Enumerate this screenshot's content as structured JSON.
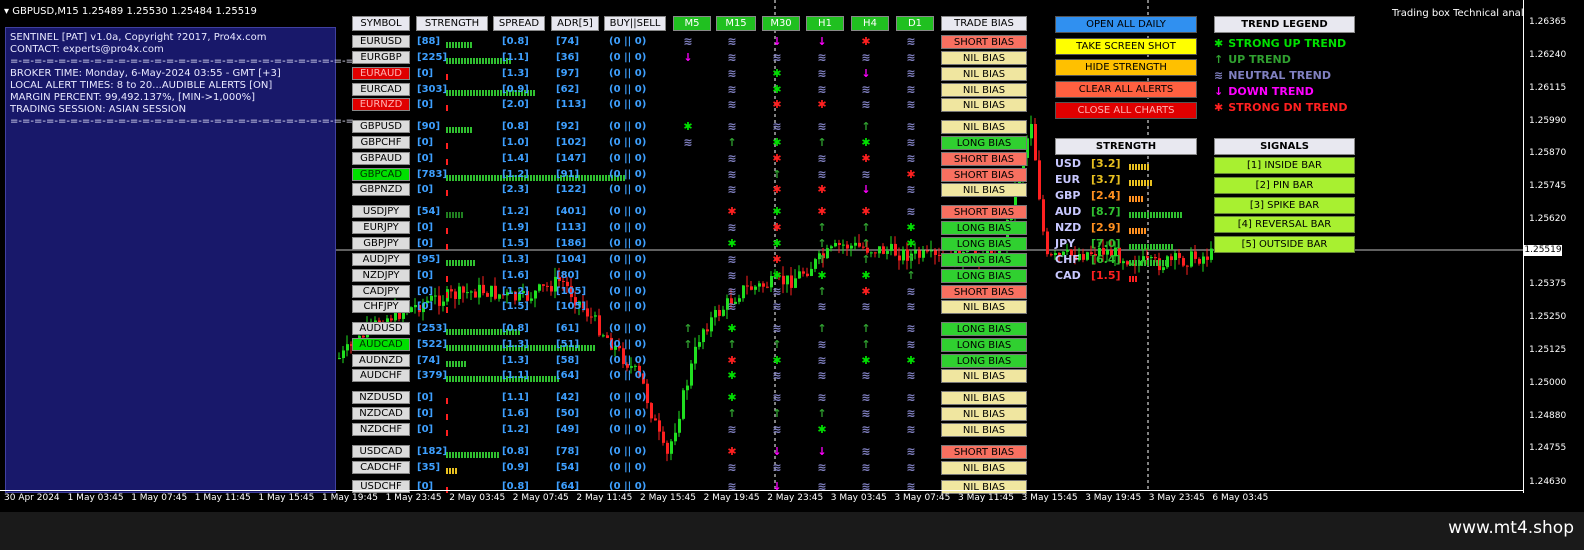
{
  "window": {
    "title": "GBPUSD,M15  1.25489 1.25530 1.25484 1.25519",
    "corner_label": "Trading box Technical analysis"
  },
  "info_panel": {
    "lines": [
      "SENTINEL [PAT] v1.0a, Copyright ?2017, Pro4x.com",
      "CONTACT: experts@pro4x.com",
      "=-=-=-=-=-=-=-=-=-=-=-=-=-=-=-=-=-=-=-=-=-=-=-=-=-=-=-=-=-",
      "BROKER TIME: Monday, 6-May-2024 03:55 - GMT [+3]",
      "LOCAL ALERT TIMES: 8 to 20...AUDIBLE ALERTS [ON]",
      "MARGIN PERCENT: 99,492.137%, [MIN->1,000%]",
      "TRADING SESSION: ASIAN SESSION",
      "=-=-=-=-=-=-=-=-=-=-=-=-=-=-=-=-=-=-=-=-=-=-=-=-=-=-=-=-=-"
    ]
  },
  "headers": {
    "symbol": "SYMBOL",
    "strength": "STRENGTH",
    "spread": "SPREAD",
    "adr": "ADR[5]",
    "buysell": "BUY||SELL",
    "timeframes": [
      "M5",
      "M15",
      "M30",
      "H1",
      "H4",
      "D1"
    ],
    "trade_bias": "TRADE BIAS"
  },
  "colors": {
    "strong_up": "#00e000",
    "up": "#30a030",
    "neutral": "#8080c0",
    "down": "#ff00ff",
    "strong_down": "#ff2020"
  },
  "icons": {
    "strong_up": "✱",
    "up": "↑",
    "neutral": "≋",
    "down": "↓",
    "strong_down": "✱"
  },
  "rows": [
    {
      "symbol": "EURUSD",
      "state": "normal",
      "strength": "[88]",
      "bars": 9,
      "bar_color": "#30c030",
      "spread": "[0.8]",
      "adr": "[74]",
      "buysell": "(0 || 0)",
      "tf": [
        "neutral",
        "neutral",
        "down",
        "down",
        "strong_down",
        "neutral"
      ],
      "bias": "SHORT BIAS",
      "bias_type": "short"
    },
    {
      "symbol": "EURGBP",
      "state": "normal",
      "strength": "[225]",
      "bars": 22,
      "bar_color": "#30c030",
      "spread": "[1.1]",
      "adr": "[36]",
      "buysell": "(0 || 0)",
      "tf": [
        "down",
        "neutral",
        "neutral",
        "neutral",
        "neutral",
        "neutral"
      ],
      "bias": "NIL BIAS",
      "bias_type": "nil"
    },
    {
      "symbol": "EURAUD",
      "state": "red",
      "strength": "[0]",
      "bars": 1,
      "bar_color": "#ff2020",
      "spread": "[1.3]",
      "adr": "[97]",
      "buysell": "(0 || 0)",
      "tf": [
        "",
        "neutral",
        "strong_up",
        "neutral",
        "down",
        "neutral"
      ],
      "bias": "NIL BIAS",
      "bias_type": "nil"
    },
    {
      "symbol": "EURCAD",
      "state": "normal",
      "strength": "[303]",
      "bars": 30,
      "bar_color": "#30c030",
      "spread": "[0.9]",
      "adr": "[62]",
      "buysell": "(0 || 0)",
      "tf": [
        "",
        "neutral",
        "strong_up",
        "neutral",
        "neutral",
        "neutral"
      ],
      "bias": "NIL BIAS",
      "bias_type": "nil"
    },
    {
      "symbol": "EURNZD",
      "state": "red",
      "strength": "[0]",
      "bars": 1,
      "bar_color": "#ff2020",
      "spread": "[2.0]",
      "adr": "[113]",
      "buysell": "(0 || 0)",
      "tf": [
        "",
        "neutral",
        "strong_down",
        "strong_down",
        "neutral",
        "neutral"
      ],
      "bias": "NIL BIAS",
      "bias_type": "nil"
    },
    {
      "symbol": "GBPUSD",
      "state": "normal",
      "strength": "[90]",
      "bars": 9,
      "bar_color": "#30c030",
      "spread": "[0.8]",
      "adr": "[92]",
      "buysell": "(0 || 0)",
      "tf": [
        "strong_up",
        "neutral",
        "neutral",
        "neutral",
        "up",
        "neutral"
      ],
      "bias": "NIL BIAS",
      "bias_type": "nil"
    },
    {
      "symbol": "GBPCHF",
      "state": "normal",
      "strength": "[0]",
      "bars": 1,
      "bar_color": "#ff2020",
      "spread": "[1.0]",
      "adr": "[102]",
      "buysell": "(0 || 0)",
      "tf": [
        "neutral",
        "up",
        "strong_up",
        "up",
        "strong_up",
        "neutral"
      ],
      "bias": "LONG BIAS",
      "bias_type": "long"
    },
    {
      "symbol": "GBPAUD",
      "state": "normal",
      "strength": "[0]",
      "bars": 1,
      "bar_color": "#ff2020",
      "spread": "[1.4]",
      "adr": "[147]",
      "buysell": "(0 || 0)",
      "tf": [
        "",
        "neutral",
        "strong_down",
        "neutral",
        "strong_down",
        "neutral"
      ],
      "bias": "SHORT BIAS",
      "bias_type": "short"
    },
    {
      "symbol": "GBPCAD",
      "state": "green",
      "strength": "[783]",
      "bars": 60,
      "bar_color": "#30c030",
      "spread": "[1.2]",
      "adr": "[91]",
      "buysell": "(0 || 0)",
      "tf": [
        "",
        "neutral",
        "up",
        "neutral",
        "neutral",
        "strong_down"
      ],
      "bias": "SHORT BIAS",
      "bias_type": "short"
    },
    {
      "symbol": "GBPNZD",
      "state": "normal",
      "strength": "[0]",
      "bars": 1,
      "bar_color": "#ff2020",
      "spread": "[2.3]",
      "adr": "[122]",
      "buysell": "(0 || 0)",
      "tf": [
        "",
        "neutral",
        "strong_down",
        "strong_down",
        "down",
        "neutral"
      ],
      "bias": "NIL BIAS",
      "bias_type": "nil"
    },
    {
      "symbol": "USDJPY",
      "state": "normal",
      "strength": "[54]",
      "bars": 6,
      "bar_color": "#208020",
      "spread": "[1.2]",
      "adr": "[401]",
      "buysell": "(0 || 0)",
      "tf": [
        "",
        "strong_down",
        "strong_up",
        "strong_down",
        "strong_down",
        "neutral"
      ],
      "bias": "SHORT BIAS",
      "bias_type": "short"
    },
    {
      "symbol": "EURJPY",
      "state": "normal",
      "strength": "[0]",
      "bars": 1,
      "bar_color": "#ff2020",
      "spread": "[1.9]",
      "adr": "[113]",
      "buysell": "(0 || 0)",
      "tf": [
        "",
        "neutral",
        "strong_down",
        "up",
        "up",
        "strong_up"
      ],
      "bias": "LONG BIAS",
      "bias_type": "long"
    },
    {
      "symbol": "GBPJPY",
      "state": "normal",
      "strength": "[0]",
      "bars": 1,
      "bar_color": "#ff2020",
      "spread": "[1.5]",
      "adr": "[186]",
      "buysell": "(0 || 0)",
      "tf": [
        "",
        "strong_up",
        "strong_up",
        "up",
        "up",
        "strong_up"
      ],
      "bias": "LONG BIAS",
      "bias_type": "long"
    },
    {
      "symbol": "AUDJPY",
      "state": "normal",
      "strength": "[95]",
      "bars": 10,
      "bar_color": "#30c030",
      "spread": "[1.3]",
      "adr": "[104]",
      "buysell": "(0 || 0)",
      "tf": [
        "",
        "neutral",
        "strong_down",
        "up",
        "up",
        "up"
      ],
      "bias": "LONG BIAS",
      "bias_type": "long"
    },
    {
      "symbol": "NZDJPY",
      "state": "normal",
      "strength": "[0]",
      "bars": 1,
      "bar_color": "#ff2020",
      "spread": "[1.6]",
      "adr": "[80]",
      "buysell": "(0 || 0)",
      "tf": [
        "",
        "neutral",
        "strong_up",
        "strong_up",
        "strong_up",
        "up"
      ],
      "bias": "LONG BIAS",
      "bias_type": "long"
    },
    {
      "symbol": "CADJPY",
      "state": "normal",
      "strength": "[0]",
      "bars": 1,
      "bar_color": "#ff2020",
      "spread": "[1.2]",
      "adr": "[105]",
      "buysell": "(0 || 0)",
      "tf": [
        "",
        "neutral",
        "neutral",
        "up",
        "strong_down",
        "neutral"
      ],
      "bias": "SHORT BIAS",
      "bias_type": "short"
    },
    {
      "symbol": "CHFJPY",
      "state": "normal",
      "strength": "[0]",
      "bars": 1,
      "bar_color": "#ff2020",
      "spread": "[1.5]",
      "adr": "[105]",
      "buysell": "(0 || 0)",
      "tf": [
        "",
        "neutral",
        "neutral",
        "neutral",
        "neutral",
        "neutral"
      ],
      "bias": "NIL BIAS",
      "bias_type": "nil"
    },
    {
      "symbol": "AUDUSD",
      "state": "normal",
      "strength": "[253]",
      "bars": 25,
      "bar_color": "#30c030",
      "spread": "[0.8]",
      "adr": "[61]",
      "buysell": "(0 || 0)",
      "tf": [
        "up",
        "strong_up",
        "neutral",
        "up",
        "up",
        "neutral"
      ],
      "bias": "LONG BIAS",
      "bias_type": "long"
    },
    {
      "symbol": "AUDCAD",
      "state": "green",
      "strength": "[522]",
      "bars": 50,
      "bar_color": "#30c030",
      "spread": "[1.3]",
      "adr": "[51]",
      "buysell": "(0 || 0)",
      "tf": [
        "up",
        "up",
        "up",
        "neutral",
        "up",
        "neutral"
      ],
      "bias": "LONG BIAS",
      "bias_type": "long"
    },
    {
      "symbol": "AUDNZD",
      "state": "normal",
      "strength": "[74]",
      "bars": 7,
      "bar_color": "#30c030",
      "spread": "[1.3]",
      "adr": "[58]",
      "buysell": "(0 || 0)",
      "tf": [
        "",
        "strong_down",
        "strong_up",
        "neutral",
        "strong_up",
        "strong_up"
      ],
      "bias": "LONG BIAS",
      "bias_type": "long"
    },
    {
      "symbol": "AUDCHF",
      "state": "normal",
      "strength": "[379]",
      "bars": 38,
      "bar_color": "#30c030",
      "spread": "[1.1]",
      "adr": "[64]",
      "buysell": "(0 || 0)",
      "tf": [
        "",
        "strong_up",
        "neutral",
        "neutral",
        "neutral",
        "neutral"
      ],
      "bias": "NIL BIAS",
      "bias_type": "nil"
    },
    {
      "symbol": "NZDUSD",
      "state": "normal",
      "strength": "[0]",
      "bars": 1,
      "bar_color": "#ff2020",
      "spread": "[1.1]",
      "adr": "[42]",
      "buysell": "(0 || 0)",
      "tf": [
        "",
        "strong_up",
        "neutral",
        "neutral",
        "neutral",
        "neutral"
      ],
      "bias": "NIL BIAS",
      "bias_type": "nil"
    },
    {
      "symbol": "NZDCAD",
      "state": "normal",
      "strength": "[0]",
      "bars": 1,
      "bar_color": "#ff2020",
      "spread": "[1.6]",
      "adr": "[50]",
      "buysell": "(0 || 0)",
      "tf": [
        "",
        "up",
        "up",
        "up",
        "neutral",
        "neutral"
      ],
      "bias": "NIL BIAS",
      "bias_type": "nil"
    },
    {
      "symbol": "NZDCHF",
      "state": "normal",
      "strength": "[0]",
      "bars": 1,
      "bar_color": "#ff2020",
      "spread": "[1.2]",
      "adr": "[49]",
      "buysell": "(0 || 0)",
      "tf": [
        "",
        "neutral",
        "neutral",
        "strong_up",
        "neutral",
        "neutral"
      ],
      "bias": "NIL BIAS",
      "bias_type": "nil"
    },
    {
      "symbol": "USDCAD",
      "state": "normal",
      "strength": "[182]",
      "bars": 18,
      "bar_color": "#30c030",
      "spread": "[0.8]",
      "adr": "[78]",
      "buysell": "(0 || 0)",
      "tf": [
        "",
        "strong_down",
        "down",
        "down",
        "neutral",
        "neutral"
      ],
      "bias": "SHORT BIAS",
      "bias_type": "short"
    },
    {
      "symbol": "CADCHF",
      "state": "normal",
      "strength": "[35]",
      "bars": 4,
      "bar_color": "#e8c020",
      "spread": "[0.9]",
      "adr": "[54]",
      "buysell": "(0 || 0)",
      "tf": [
        "",
        "neutral",
        "neutral",
        "neutral",
        "neutral",
        "neutral"
      ],
      "bias": "NIL BIAS",
      "bias_type": "nil"
    },
    {
      "symbol": "USDCHF",
      "state": "normal",
      "strength": "[0]",
      "bars": 1,
      "bar_color": "#ff2020",
      "spread": "[0.8]",
      "adr": "[64]",
      "buysell": "(0 || 0)",
      "tf": [
        "",
        "neutral",
        "down",
        "neutral",
        "neutral",
        "neutral"
      ],
      "bias": "NIL BIAS",
      "bias_type": "nil"
    }
  ],
  "actions": [
    {
      "label": "OPEN ALL DAILY",
      "bg": "#3090f0",
      "fg": "#000"
    },
    {
      "label": "TAKE SCREEN SHOT",
      "bg": "#ffff00",
      "fg": "#000"
    },
    {
      "label": "HIDE STRENGTH",
      "bg": "#ffc000",
      "fg": "#000"
    },
    {
      "label": "CLEAR ALL ALERTS",
      "bg": "#ff6040",
      "fg": "#000"
    },
    {
      "label": "CLOSE ALL CHARTS",
      "bg": "#e00000",
      "fg": "#ffb0b0"
    }
  ],
  "trend_legend": {
    "title": "TREND LEGEND",
    "items": [
      {
        "icon": "✱",
        "label": "STRONG UP TREND",
        "color": "#00e000"
      },
      {
        "icon": "↑",
        "label": "UP TREND",
        "color": "#30a030"
      },
      {
        "icon": "≋",
        "label": "NEUTRAL TREND",
        "color": "#8080c0"
      },
      {
        "icon": "↓",
        "label": "DOWN TREND",
        "color": "#ff00ff"
      },
      {
        "icon": "✱",
        "label": "STRONG DN TREND",
        "color": "#ff2020"
      }
    ]
  },
  "strength_panel": {
    "title": "STRENGTH",
    "items": [
      {
        "currency": "USD",
        "value": "[3.2]",
        "bars": 7,
        "color": "#e8c020"
      },
      {
        "currency": "EUR",
        "value": "[3.7]",
        "bars": 8,
        "color": "#e8c020"
      },
      {
        "currency": "GBP",
        "value": "[2.4]",
        "bars": 5,
        "color": "#ff9020"
      },
      {
        "currency": "AUD",
        "value": "[8.7]",
        "bars": 18,
        "color": "#30c030"
      },
      {
        "currency": "NZD",
        "value": "[2.9]",
        "bars": 6,
        "color": "#ff9020"
      },
      {
        "currency": "JPY",
        "value": "[7.0]",
        "bars": 15,
        "color": "#30c030"
      },
      {
        "currency": "CHF",
        "value": "[6.4]",
        "bars": 13,
        "color": "#30c030"
      },
      {
        "currency": "CAD",
        "value": "[1.5]",
        "bars": 3,
        "color": "#ff2020"
      }
    ]
  },
  "signals": {
    "title": "SIGNALS",
    "items": [
      "[1] INSIDE BAR",
      "[2] PIN BAR",
      "[3] SPIKE BAR",
      "[4] REVERSAL BAR",
      "[5] OUTSIDE BAR"
    ]
  },
  "price_axis": {
    "labels": [
      "1.26365",
      "1.26240",
      "1.26115",
      "1.25990",
      "1.25870",
      "1.25745",
      "1.25620",
      "1.25375",
      "1.25250",
      "1.25125",
      "1.25000",
      "1.24880",
      "1.24755",
      "1.24630"
    ],
    "current": "1.25519"
  },
  "time_axis": {
    "labels": [
      "30 Apr 2024",
      "1 May 03:45",
      "1 May 07:45",
      "1 May 11:45",
      "1 May 15:45",
      "1 May 19:45",
      "1 May 23:45",
      "2 May 03:45",
      "2 May 07:45",
      "2 May 11:45",
      "2 May 15:45",
      "2 May 19:45",
      "2 May 23:45",
      "3 May 03:45",
      "3 May 07:45",
      "3 May 11:45",
      "3 May 15:45",
      "3 May 19:45",
      "3 May 23:45",
      "6 May 03:45"
    ]
  },
  "footer": {
    "watermark": "www.mt4.shop"
  }
}
